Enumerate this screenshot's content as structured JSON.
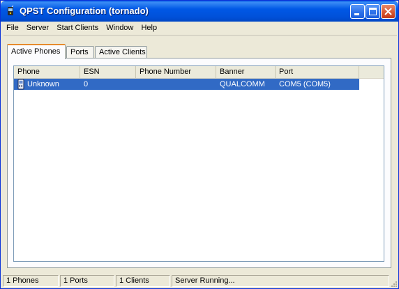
{
  "window": {
    "title": "QPST Configuration (tornado)"
  },
  "menu": [
    "File",
    "Server",
    "Start Clients",
    "Window",
    "Help"
  ],
  "tabs": [
    "Active Phones",
    "Ports",
    "Active Clients"
  ],
  "list": {
    "columns": [
      "Phone",
      "ESN",
      "Phone Number",
      "Banner",
      "Port"
    ],
    "rows": [
      {
        "phone": "Unknown",
        "esn": "0",
        "phone_number": "",
        "banner": "QUALCOMM",
        "port": "COM5 (COM5)"
      }
    ]
  },
  "status": [
    "1 Phones",
    "1 Ports",
    "1 Clients",
    "Server Running..."
  ],
  "icons": {
    "app": "qpst-app-icon",
    "phone": "mobile-phone-icon"
  },
  "colors": {
    "title_bar": "#0058e6",
    "selection": "#316ac5",
    "active_tab_accent": "#e68b2c"
  }
}
